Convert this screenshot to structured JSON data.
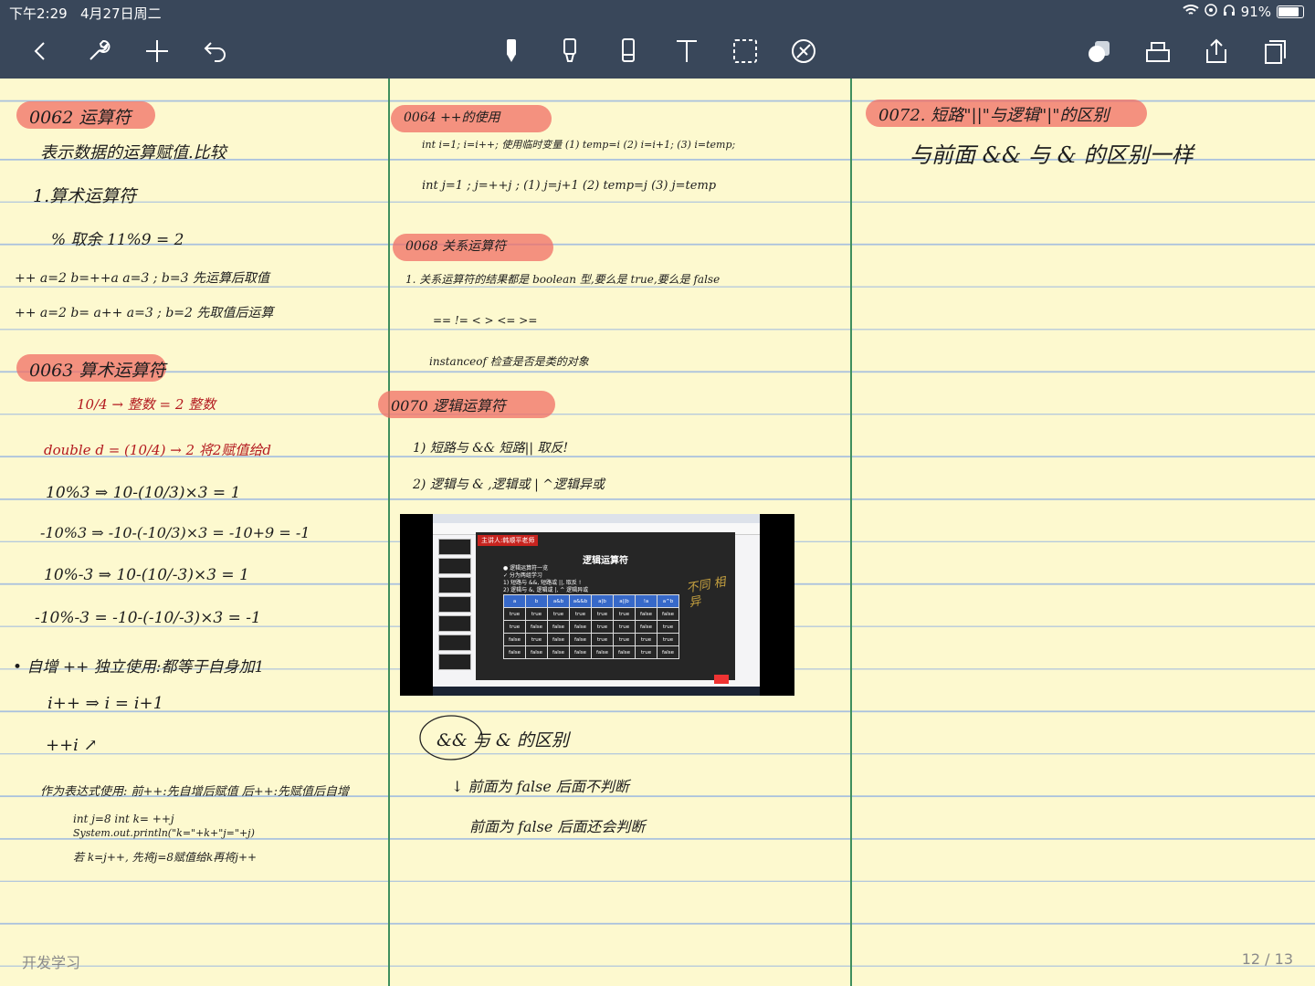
{
  "status_bar": {
    "time": "下午2:29",
    "date": "4月27日周二",
    "battery": "91%",
    "battery_level": 0.91
  },
  "toolbar": {
    "left_icons": [
      "chevron-left-icon",
      "wrench-icon",
      "plus-icon",
      "undo-icon"
    ],
    "tool_icons": [
      "pen-icon",
      "highlighter-icon",
      "eraser-icon",
      "text-icon",
      "lasso-icon",
      "laser-pointer-icon"
    ],
    "selected_tool": "pen-icon",
    "right_icons": [
      "shapes-icon",
      "tray-icon",
      "share-icon",
      "pages-icon"
    ],
    "accent_color": "#39475a"
  },
  "notes": {
    "col1": {
      "heading_1": "0062 运算符",
      "line_1": "表示数据的运算赋值.比较",
      "line_2": "1.算术运算符",
      "line_3": "%  取余        11%9 = 2",
      "line_4": "++    a=2  b=++a     a=3 ; b=3   先运算后取值",
      "line_5": "++    a=2  b= a++     a=3 ; b=2   先取值后运算",
      "heading_2": "0063 算术运算符",
      "line_6": "10/4 → 整数 = 2  整数",
      "line_7": "double d = (10/4) → 2  将2赋值给d",
      "line_8": "10%3  ⇒  10-(10/3)×3 = 1",
      "line_9": "-10%3  ⇒  -10-(-10/3)×3 = -10+9 = -1",
      "line_10": "10%-3  ⇒  10-(10/-3)×3 = 1",
      "line_11": "-10%-3 = -10-(-10/-3)×3 = -1",
      "line_12": "•  自增 ++      独立使用:都等于自身加1",
      "line_13": "i++   ⇒  i = i+1",
      "line_14": "++i  ↗",
      "line_15": "作为表达式使用:  前++:先自增后赋值   后++:先赋值后自增",
      "line_16": "int j=8   int k= ++j",
      "line_17": "System.out.println(\"k=\"+k+\"j=\"+j)",
      "line_18": "若 k=j++, 先将j=8赋值给k再将j++"
    },
    "col2": {
      "heading_1": "0064  ++的使用",
      "line_1": "int i=1;  i=i++; 使用临时变量 (1) temp=i (2) i=i+1; (3) i=temp;",
      "line_2": "int j=1 ;  j=++j ;  (1) j=j+1  (2) temp=j  (3) j=temp",
      "heading_2": "0068  关系运算符",
      "line_3": "1.  关系运算符的结果都是 boolean 型,要么是 true,要么是 false",
      "line_4": "==     !=     <     >     <=     >=",
      "line_5": "instanceof     检查是否是类的对象",
      "heading_3": "0070  逻辑运算符",
      "line_6": "1)  短路与 &&    短路|| 取反!",
      "line_7": "2)  逻辑与 & ,逻辑或 |   ^逻辑异或",
      "line_8": "&& 与 & 的区别",
      "line_9": "↓ 前面为 false 后面不判断",
      "line_10": "前面为 false 后面还会判断"
    },
    "col3": {
      "heading_1": "0072. 短路\"||\"与逻辑\"|\"的区别",
      "line_1": "与前面  &&  与  & 的区别一样"
    }
  },
  "video": {
    "presenter": "主讲人:韩顺平老师",
    "slide_title": "逻辑运算符",
    "bullets": [
      "●  逻辑运算符一览",
      "✓  分为两组学习",
      "1) 短路与 &&, 短路或 ||, 取反 !",
      "2) 逻辑与 &, 逻辑或 |, ^ 逻辑异或"
    ],
    "table_header": [
      "a",
      "b",
      "a&b",
      "a&&b",
      "a|b",
      "a||b",
      "!a",
      "a^b"
    ],
    "table_rows": [
      [
        "true",
        "true",
        "true",
        "true",
        "true",
        "true",
        "false",
        "false"
      ],
      [
        "true",
        "false",
        "false",
        "false",
        "true",
        "true",
        "false",
        "true"
      ],
      [
        "false",
        "true",
        "false",
        "false",
        "true",
        "true",
        "true",
        "true"
      ],
      [
        "false",
        "false",
        "false",
        "false",
        "false",
        "false",
        "true",
        "false"
      ]
    ],
    "annotation": "不同 相异"
  },
  "footer": {
    "notebook": "开发学习",
    "page": "12 / 13"
  }
}
